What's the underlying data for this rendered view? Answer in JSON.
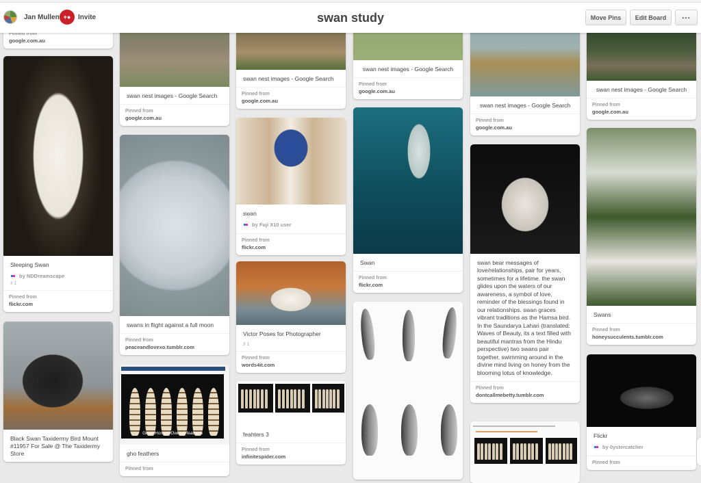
{
  "header": {
    "user_name": "Jan Mullen",
    "invite_label": "Invite",
    "board_title": "swan study",
    "buttons": {
      "move_pins": "Move Pins",
      "edit_board": "Edit Board",
      "more": "•••"
    }
  },
  "columns": [
    {
      "pins": [
        {
          "pinned_label": "Pinned from",
          "source": "google.com.au"
        },
        {
          "description": "Sleeping Swan",
          "attribution": "by NDDreamscape",
          "repins": "1",
          "pinned_label": "Pinned from",
          "source": "flickr.com"
        },
        {
          "description": "Black Swan Taxidermy Bird Mount #11957 For Sale @ The Taxidermy Store"
        }
      ]
    },
    {
      "pins": [
        {
          "description": "swan nest images - Google Search",
          "pinned_label": "Pinned from",
          "source": "google.com.au"
        },
        {
          "description": "swans in flight against a full moon",
          "pinned_label": "Pinned from",
          "source": "peaceandlovexo.tumblr.com"
        },
        {
          "description": "gho feathers",
          "image_caption": "Great Horned Owl tail feathers",
          "pinned_label": "Pinned from"
        }
      ]
    },
    {
      "pins": [
        {
          "description": "swan nest images - Google Search",
          "pinned_label": "Pinned from",
          "source": "google.com.au"
        },
        {
          "description": "swan",
          "attribution": "by Fuji X10 user",
          "pinned_label": "Pinned from",
          "source": "flickr.com"
        },
        {
          "description": "Victor Poses for Photographer",
          "repins": "1",
          "pinned_label": "Pinned from",
          "source": "words4it.com"
        },
        {
          "description": "feahters 3",
          "pinned_label": "Pinned from",
          "source": "infinitespider.com"
        }
      ]
    },
    {
      "pins": [
        {
          "description": "swan nest images - Google Search",
          "pinned_label": "Pinned from",
          "source": "google.com.au"
        },
        {
          "description": "Swan",
          "pinned_label": "Pinned from",
          "source": "flickr.com"
        },
        {
          "description": ""
        }
      ]
    },
    {
      "pins": [
        {
          "description": "swan nest images - Google Search",
          "pinned_label": "Pinned from",
          "source": "google.com.au"
        },
        {
          "description": "swan bear messages of love/relationships, pair for years, sometimes for a lifetime. the swan glides upon the waters of our awareness, a symbol of love, reminder of the blessings found in our relationships. swan graces vibrant traditions as the Hamsa bird. In the Saundarya Lahari (translated: Waves of Beauty, its a text filled with beautiful mantras from the Hindu perspective) two swans pair together, swimming around in the divine mind living on honey from the blooming lotus of knowledge.",
          "pinned_label": "Pinned from",
          "source": "dontcallmebetty.tumblr.com"
        },
        {
          "description": ""
        }
      ]
    },
    {
      "pins": [
        {
          "description": "swan nest images - Google Search",
          "pinned_label": "Pinned from",
          "source": "google.com.au"
        },
        {
          "description": "Swans",
          "pinned_label": "Pinned from",
          "source": "honeysucculents.tumblr.com"
        },
        {
          "description": "Flickr",
          "attribution": "by 0ystercatcher",
          "pinned_label": "Pinned from"
        }
      ]
    }
  ]
}
